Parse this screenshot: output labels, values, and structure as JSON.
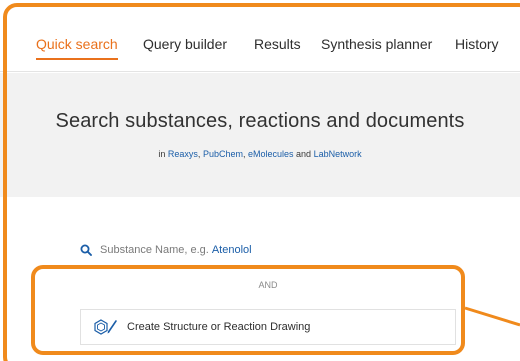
{
  "nav": {
    "items": [
      {
        "label": "Quick search",
        "active": true
      },
      {
        "label": "Query builder",
        "active": false
      },
      {
        "label": "Results",
        "active": false
      },
      {
        "label": "Synthesis planner",
        "active": false
      },
      {
        "label": "History",
        "active": false
      }
    ]
  },
  "hero": {
    "title": "Search substances, reactions and documents",
    "sub_prefix": "in",
    "sources": [
      "Reaxys",
      "PubChem",
      "eMolecules"
    ],
    "sub_and": "and",
    "last_source": "LabNetwork"
  },
  "search": {
    "placeholder": "Substance Name, e.g.",
    "example": "Atenolol"
  },
  "operator": "AND",
  "drawing": {
    "label": "Create Structure or Reaction Drawing"
  },
  "colors": {
    "accent": "#e9711c",
    "highlight": "#f08a1c",
    "link": "#1b5ea8"
  }
}
